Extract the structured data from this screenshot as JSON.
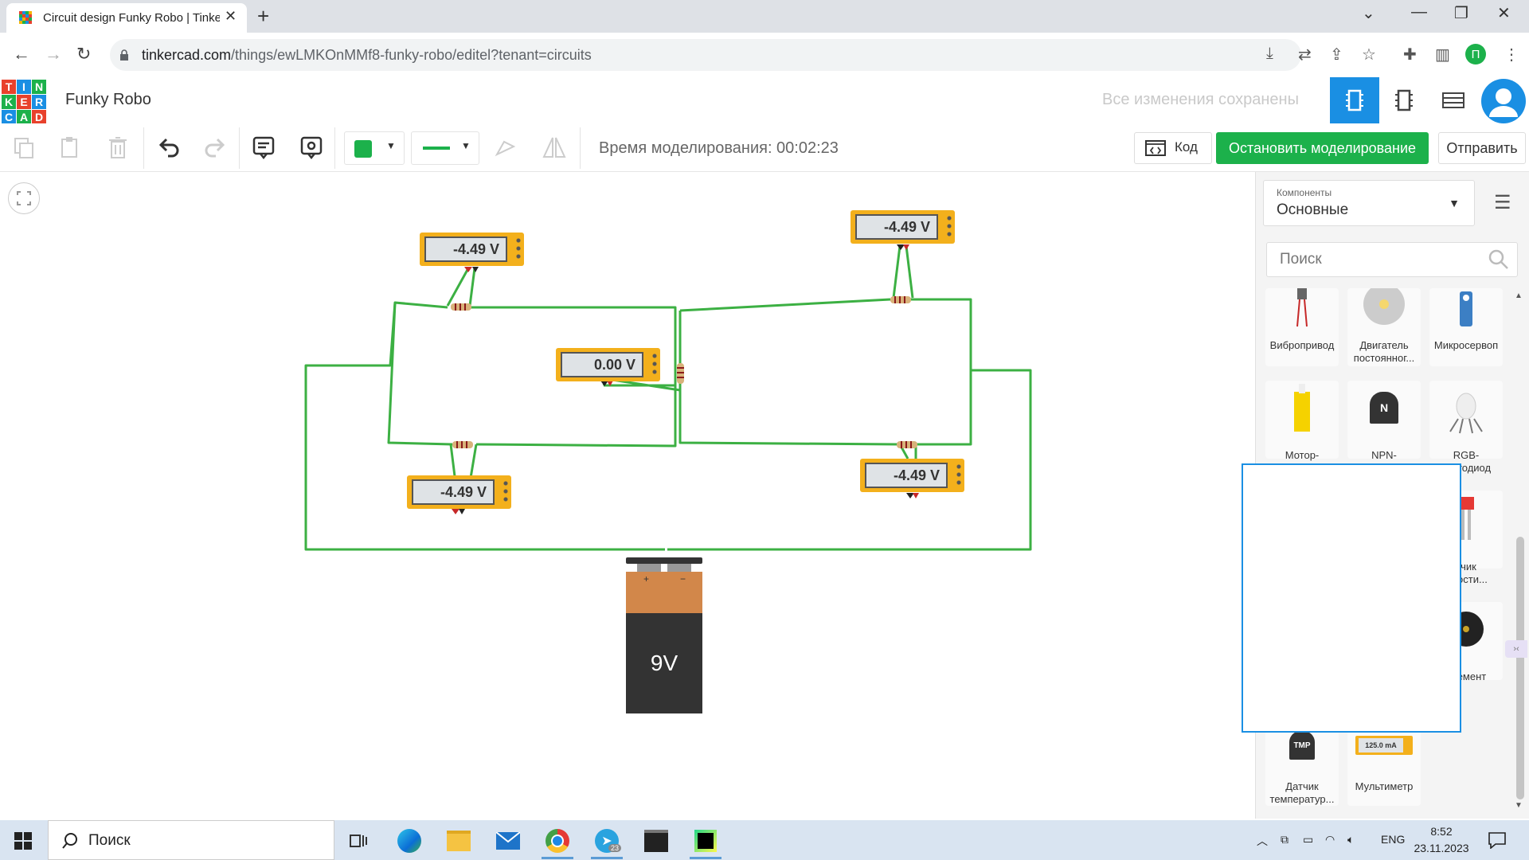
{
  "browser": {
    "tab_title": "Circuit design Funky Robo | Tinkercad",
    "url_host": "tinkercad.com",
    "url_path": "/things/ewLMKOnMMf8-funky-robo/editel?tenant=circuits",
    "profile_initial": "П"
  },
  "app": {
    "logo_letters": [
      "T",
      "I",
      "N",
      "K",
      "E",
      "R",
      "C",
      "A",
      "D"
    ],
    "logo_colors": [
      "#e8412c",
      "#1a8fe3",
      "#1cb14b",
      "#1cb14b",
      "#e8412c",
      "#1a8fe3",
      "#1a8fe3",
      "#1cb14b",
      "#e8412c"
    ],
    "project_name": "Funky Robo",
    "saved_status": "Все изменения сохранены",
    "accent": "#1a8fe3",
    "sim_green": "#1cb14b"
  },
  "toolbar": {
    "sim_time_label": "Время моделирования: 00:02:23",
    "code_label": "Код",
    "stop_sim_label": "Остановить моделирование",
    "send_label": "Отправить"
  },
  "circuit": {
    "meters": [
      {
        "name": "meter-top-left",
        "reading": "-4.49 V"
      },
      {
        "name": "meter-top-right",
        "reading": "-4.49 V"
      },
      {
        "name": "meter-center",
        "reading": "0.00 V"
      },
      {
        "name": "meter-bottom-left",
        "reading": "-4.49 V"
      },
      {
        "name": "meter-bottom-right",
        "reading": "-4.49 V"
      }
    ],
    "battery": {
      "label": "9V",
      "plus": "+",
      "minus": "−"
    }
  },
  "panel": {
    "components_label": "Компоненты",
    "components_value": "Основные",
    "search_placeholder": "Поиск",
    "items": [
      {
        "label": "Вибропривод"
      },
      {
        "label": "Двигатель постоянног..."
      },
      {
        "label": "Микросервоп"
      },
      {
        "label": "Мотор-"
      },
      {
        "label": "NPN-"
      },
      {
        "label": "RGB-\nсветодиод"
      },
      {
        "label": "тчик\nжности..."
      },
      {
        "label": "элемент"
      },
      {
        "label": "Датчик температур..."
      },
      {
        "label": "Мультиметр"
      }
    ],
    "multimeter_icon_text": "125.0 mA",
    "tmp_icon_text": "TMP",
    "npn_icon_text": "N"
  },
  "taskbar": {
    "search_label": "Поиск",
    "lang": "ENG",
    "time": "8:52",
    "date": "23.11.2023",
    "telegram_badge": "23"
  }
}
